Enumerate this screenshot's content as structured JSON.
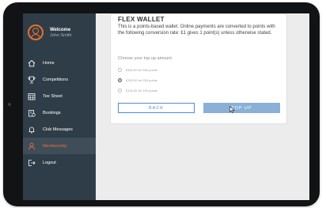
{
  "sidebar": {
    "welcome": "Welcome",
    "username": "John Smith",
    "items": [
      {
        "label": "Home",
        "icon": "home-icon",
        "active": false
      },
      {
        "label": "Competitions",
        "icon": "trophy-icon",
        "active": false
      },
      {
        "label": "Tee Sheet",
        "icon": "calendar-icon",
        "active": false
      },
      {
        "label": "Bookings",
        "icon": "bookings-icon",
        "active": false
      },
      {
        "label": "Club Messages",
        "icon": "bell-icon",
        "active": false
      },
      {
        "label": "Membership",
        "icon": "user-icon",
        "active": true
      },
      {
        "label": "Logout",
        "icon": "logout-icon",
        "active": false
      }
    ]
  },
  "wallet": {
    "title": "FLEX WALLET",
    "description": "This is a points-based wallet. Online payments are converted to points with the following conversion rate: £1 gives 1 point(s) unless otherwise stated.",
    "choose_label": "Choose your top up amount",
    "options": [
      {
        "label": "£500.00 for 500 points",
        "selected": false
      },
      {
        "label": "£200.00 for 200 points",
        "selected": true
      },
      {
        "label": "£100.00 for 100 points",
        "selected": false
      }
    ],
    "back_label": "BACK",
    "topup_label": "TOP UP"
  },
  "colors": {
    "accent": "#e8702a",
    "sidebar": "#2f3d48",
    "primary_button": "#8ab0d6",
    "outline_button": "#4d8fc9"
  }
}
